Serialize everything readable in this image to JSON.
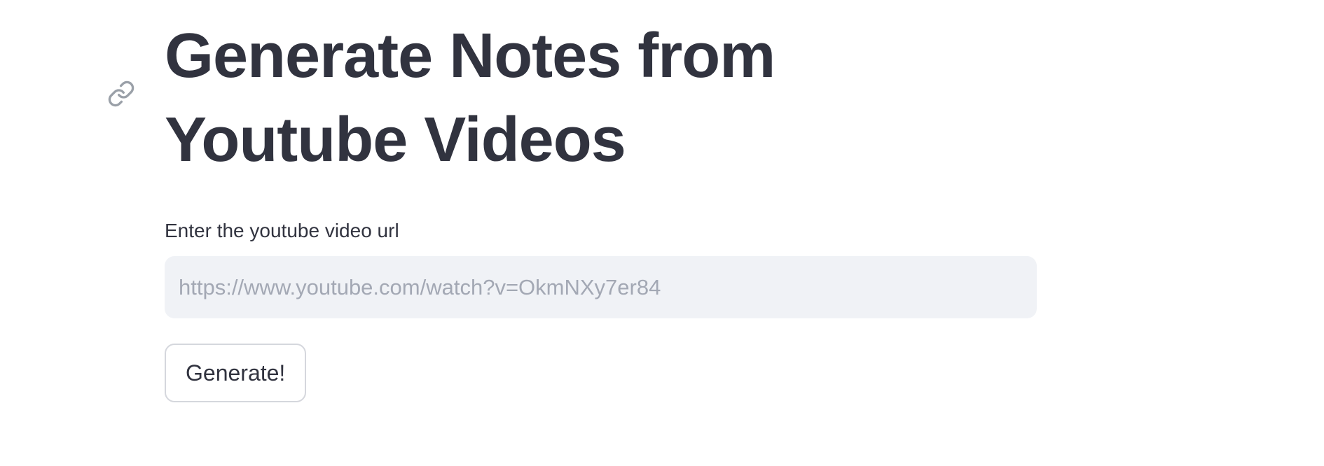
{
  "header": {
    "title": "Generate Notes from Youtube Videos",
    "anchor_icon": "link-icon"
  },
  "form": {
    "url_label": "Enter the youtube video url",
    "url_value": "",
    "url_placeholder": "https://www.youtube.com/watch?v=OkmNXy7er84",
    "submit_label": "Generate!"
  },
  "colors": {
    "text": "#31333f",
    "input_background": "#f0f2f6",
    "placeholder": "#a3a8b4",
    "button_border": "#d5d7dd",
    "icon": "#9aa0a8"
  }
}
